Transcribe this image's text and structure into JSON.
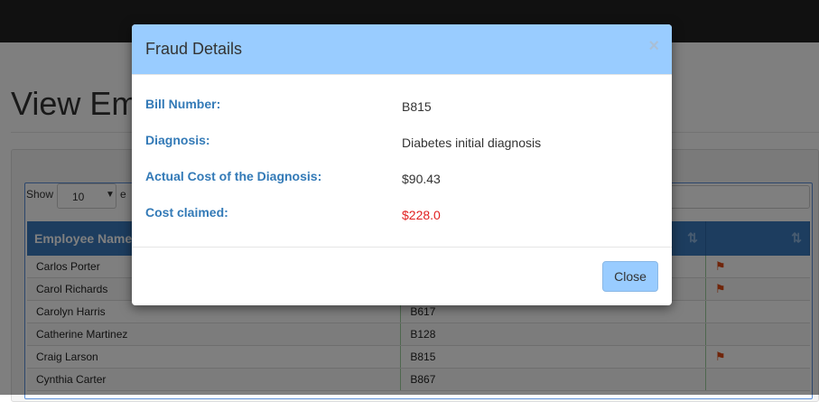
{
  "page": {
    "title_visible": "View Em",
    "length_menu": {
      "prefix": "Show",
      "value": "10",
      "suffix_visible": "e"
    }
  },
  "table": {
    "columns": [
      "Employee Name",
      "",
      ""
    ],
    "rows": [
      {
        "name": "Carlos Porter",
        "bill": "",
        "flag": true
      },
      {
        "name": "Carol Richards",
        "bill": "",
        "flag": true
      },
      {
        "name": "Carolyn Harris",
        "bill": "B617",
        "flag": false
      },
      {
        "name": "Catherine Martinez",
        "bill": "B128",
        "flag": false
      },
      {
        "name": "Craig Larson",
        "bill": "B815",
        "flag": true
      },
      {
        "name": "Cynthia Carter",
        "bill": "B867",
        "flag": false
      }
    ]
  },
  "modal": {
    "title": "Fraud Details",
    "close_symbol": "×",
    "fields": [
      {
        "label": "Bill Number:",
        "value": "B815"
      },
      {
        "label": "Diagnosis:",
        "value": "Diabetes initial diagnosis"
      },
      {
        "label": "Actual Cost of the Diagnosis:",
        "value": "$90.43"
      },
      {
        "label": "Cost claimed:",
        "value": "$228.0"
      }
    ],
    "close_button": "Close"
  },
  "colors": {
    "modal_header": "#99ccff",
    "label_blue": "#337ab7",
    "claimed_red": "#e02020",
    "table_header": "#3a7bbf",
    "flag": "#e04b14"
  },
  "icons": {
    "flag": "flag-icon",
    "sort": "sort-icon",
    "close": "close-icon",
    "caret": "caret-down-icon"
  }
}
